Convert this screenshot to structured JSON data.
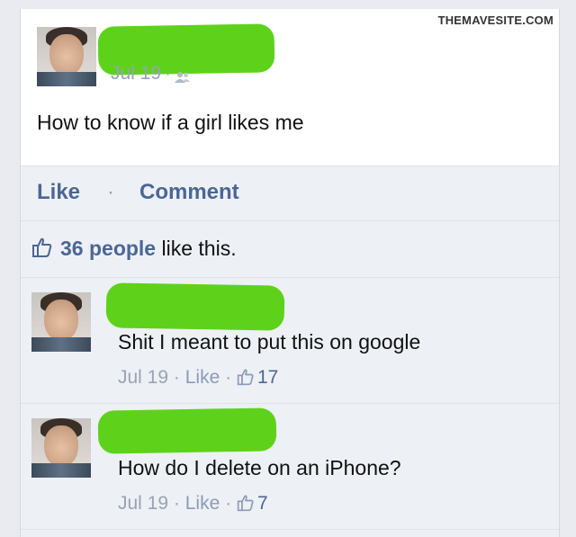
{
  "watermark": "THEMAVESITE.COM",
  "post": {
    "date": "Jul 19",
    "separator": "·",
    "privacy_icon": "friends-icon",
    "text": "How to know if a girl likes me"
  },
  "actions": {
    "like_label": "Like",
    "separator": "·",
    "comment_label": "Comment"
  },
  "likes": {
    "icon": "thumbs-up-icon",
    "people": "36 people",
    "suffix": " like this."
  },
  "comments": [
    {
      "text": "Shit I meant to put this on google",
      "date": "Jul 19",
      "separator": "·",
      "like_label": "Like",
      "separator2": "·",
      "like_count": "17"
    },
    {
      "text": "How do I delete on an iPhone?",
      "date": "Jul 19",
      "separator": "·",
      "like_label": "Like",
      "separator2": "·",
      "like_count": "7"
    }
  ],
  "colors": {
    "link_blue": "#4c6694",
    "meta_gray": "#9aa3b3",
    "redaction_green": "#5ed21b",
    "card_bg": "#edf0f5"
  }
}
